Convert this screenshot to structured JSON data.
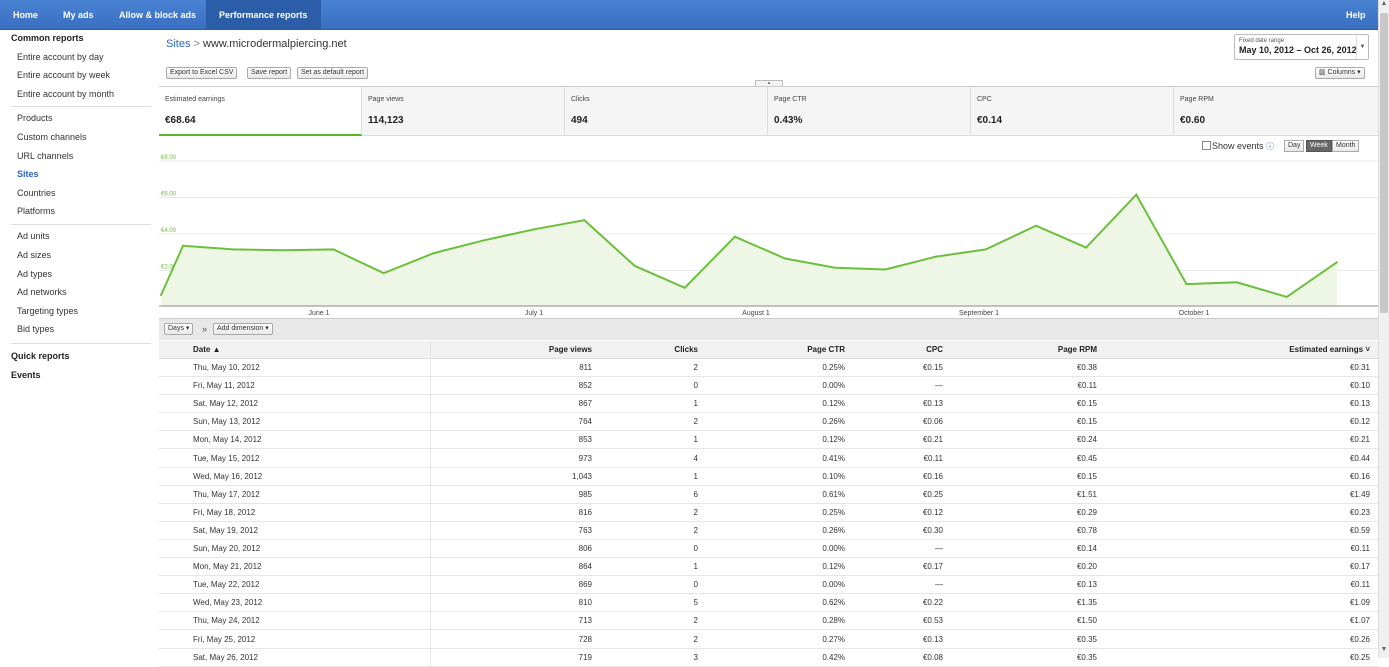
{
  "nav": {
    "home": "Home",
    "my_ads": "My ads",
    "allow_block": "Allow & block ads",
    "perf_reports": "Performance reports",
    "help": "Help"
  },
  "sidebar": {
    "common_reports": "Common reports",
    "items": [
      "Entire account by day",
      "Entire account by week",
      "Entire account by month"
    ],
    "items2": [
      "Products",
      "Custom channels",
      "URL channels",
      "Sites",
      "Countries",
      "Platforms"
    ],
    "items3": [
      "Ad units",
      "Ad sizes",
      "Ad types",
      "Ad networks",
      "Targeting types",
      "Bid types"
    ],
    "quick_reports": "Quick reports",
    "events": "Events"
  },
  "breadcrumb": {
    "root": "Sites",
    "sep": ">",
    "current": "www.microdermalpiercing.net"
  },
  "buttons": {
    "export": "Export to Excel CSV",
    "save": "Save report",
    "default": "Set as default report",
    "columns": "▥ Columns ▾"
  },
  "date_range": {
    "label": "Fixed date range",
    "value": "May 10, 2012 – Oct 26, 2012"
  },
  "metrics": [
    {
      "label": "Estimated earnings",
      "value": "€68.64"
    },
    {
      "label": "Page views",
      "value": "114,123"
    },
    {
      "label": "Clicks",
      "value": "494"
    },
    {
      "label": "Page CTR",
      "value": "0.43%"
    },
    {
      "label": "CPC",
      "value": "€0.14"
    },
    {
      "label": "Page RPM",
      "value": "€0.60"
    }
  ],
  "chart_controls": {
    "show_events": "Show events",
    "day": "Day",
    "week": "Week",
    "month": "Month"
  },
  "chart_data": {
    "type": "area",
    "series": [
      {
        "values": [
          0.6,
          3.3,
          3.1,
          3.05,
          3.1,
          1.8,
          2.9,
          3.6,
          4.2,
          4.7,
          2.2,
          1.0,
          3.8,
          2.6,
          2.1,
          2.0,
          2.7,
          3.1,
          4.4,
          3.2,
          6.1,
          1.2,
          1.3,
          0.5,
          2.4
        ]
      }
    ],
    "ylim": [
      0,
      8
    ],
    "ytick_labels": [
      "€8.00",
      "€6.00",
      "€4.00",
      "€2.00"
    ],
    "xtick_labels": [
      "June 1",
      "July 1",
      "August 1",
      "September 1",
      "October 1"
    ],
    "color": "#6cbf3c",
    "fill": "#eef7e6"
  },
  "dim": {
    "days": "Days ▾",
    "arrow": "»",
    "add": "Add dimension ▾"
  },
  "table": {
    "headers": [
      "Date ▲",
      "Page views",
      "Clicks",
      "Page CTR",
      "CPC",
      "Page RPM",
      "Estimated earnings ˅"
    ],
    "rows": [
      [
        "Thu, May 10, 2012",
        "811",
        "2",
        "0.25%",
        "€0.15",
        "€0.38",
        "€0.31"
      ],
      [
        "Fri, May 11, 2012",
        "852",
        "0",
        "0.00%",
        "—",
        "€0.11",
        "€0.10"
      ],
      [
        "Sat, May 12, 2012",
        "867",
        "1",
        "0.12%",
        "€0.13",
        "€0.15",
        "€0.13"
      ],
      [
        "Sun, May 13, 2012",
        "764",
        "2",
        "0.26%",
        "€0.06",
        "€0.15",
        "€0.12"
      ],
      [
        "Mon, May 14, 2012",
        "853",
        "1",
        "0.12%",
        "€0.21",
        "€0.24",
        "€0.21"
      ],
      [
        "Tue, May 15, 2012",
        "973",
        "4",
        "0.41%",
        "€0.11",
        "€0.45",
        "€0.44"
      ],
      [
        "Wed, May 16, 2012",
        "1,043",
        "1",
        "0.10%",
        "€0.16",
        "€0.15",
        "€0.16"
      ],
      [
        "Thu, May 17, 2012",
        "985",
        "6",
        "0.61%",
        "€0.25",
        "€1.51",
        "€1.49"
      ],
      [
        "Fri, May 18, 2012",
        "816",
        "2",
        "0.25%",
        "€0.12",
        "€0.29",
        "€0.23"
      ],
      [
        "Sat, May 19, 2012",
        "763",
        "2",
        "0.26%",
        "€0.30",
        "€0.78",
        "€0.59"
      ],
      [
        "Sun, May 20, 2012",
        "806",
        "0",
        "0.00%",
        "—",
        "€0.14",
        "€0.11"
      ],
      [
        "Mon, May 21, 2012",
        "864",
        "1",
        "0.12%",
        "€0.17",
        "€0.20",
        "€0.17"
      ],
      [
        "Tue, May 22, 2012",
        "869",
        "0",
        "0.00%",
        "—",
        "€0.13",
        "€0.11"
      ],
      [
        "Wed, May 23, 2012",
        "810",
        "5",
        "0.62%",
        "€0.22",
        "€1.35",
        "€1.09"
      ],
      [
        "Thu, May 24, 2012",
        "713",
        "2",
        "0.28%",
        "€0.53",
        "€1.50",
        "€1.07"
      ],
      [
        "Fri, May 25, 2012",
        "728",
        "2",
        "0.27%",
        "€0.13",
        "€0.35",
        "€0.26"
      ],
      [
        "Sat, May 26, 2012",
        "719",
        "3",
        "0.42%",
        "€0.08",
        "€0.35",
        "€0.25"
      ]
    ]
  }
}
